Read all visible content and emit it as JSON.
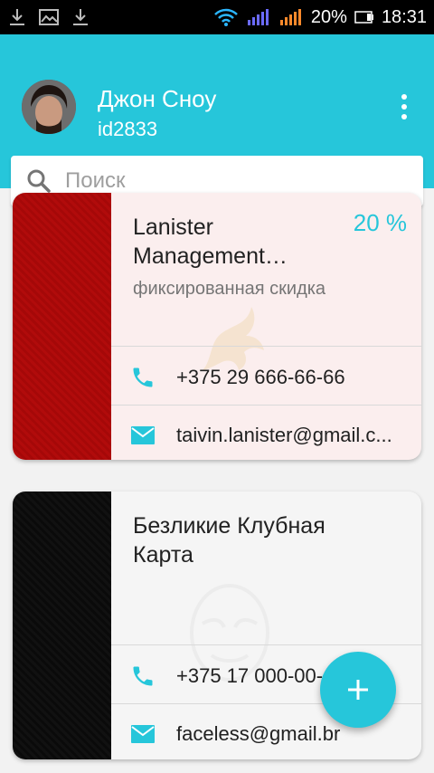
{
  "status_bar": {
    "battery": "20%",
    "time": "18:31",
    "icons": [
      "download-icon",
      "image-icon",
      "download-icon",
      "wifi-icon",
      "signal-icon",
      "signal-icon",
      "battery-icon"
    ]
  },
  "header": {
    "user_name": "Джон Сноу",
    "user_id": "id2833",
    "menu_icon": "more-vert-icon",
    "accent_color": "#26c6da"
  },
  "search": {
    "placeholder": "Поиск",
    "value": ""
  },
  "cards": [
    {
      "title": "Lanister Management…",
      "subtitle": "фиксированная скидка",
      "discount": "20 %",
      "phone": "+375 29 666-66-66",
      "email": "taivin.lanister@gmail.c...",
      "strip_color": "#b10b0b"
    },
    {
      "title": "Безликие Клубная Карта",
      "phone": "+375 17 000-00-",
      "email": "faceless@gmail.br",
      "strip_color": "#111111"
    }
  ],
  "fab": {
    "icon": "plus-icon"
  }
}
